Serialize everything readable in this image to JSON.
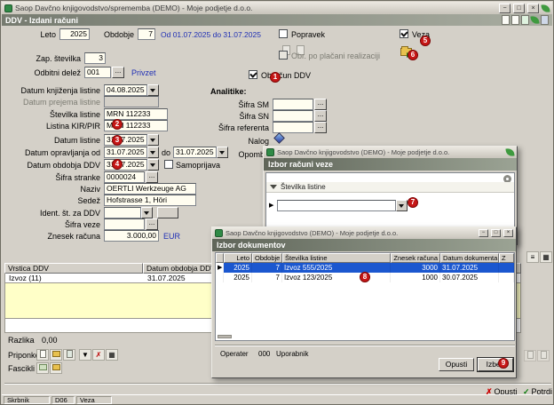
{
  "window": {
    "title": "Saop Davčno knjigovodstvo/sprememba (DEMO) - Moje podjetje d.o.o.",
    "form_title": "DDV - Izdani računi"
  },
  "icons": {
    "minimize": "−",
    "maximize": "□",
    "close": "×",
    "ellipsis": "...",
    "marker": "▶",
    "cross": "✗",
    "check": "✓",
    "lines": "≡",
    "grid": "▦",
    "down": "▼"
  },
  "top": {
    "leto_label": "Leto",
    "leto": "2025",
    "obdobje_label": "Obdobje",
    "obdobje": "7",
    "obdobje_range": "Od 01.07.2025 do 31.07.2025",
    "zap_label": "Zap. številka",
    "zap": "3",
    "odbitni_label": "Odbitni delež",
    "odbitni": "001",
    "privzet": "Privzet",
    "cb_popravek": "Popravek",
    "cb_veza": "Veza",
    "cb_obr": "Obr. po plačani realizaciji",
    "cb_obracun": "Obračun DDV"
  },
  "left": {
    "knjizenja_label": "Datum knjiženja listine",
    "knjizenja": "04.08.2025",
    "prejema_label": "Datum prejema listine",
    "prejema": "",
    "stevilka_label": "Številka listine",
    "stevilka": "MRN 112233",
    "kir_label": "Listina KIR/PIR",
    "kir": "MRN 112233",
    "datum_label": "Datum listine",
    "datum": "31.07.2025",
    "opravljanja_label": "Datum opravljanja od",
    "do_label": "do",
    "opravljanja_od": "31.07.2025",
    "opravljanja_do": "31.07.2025",
    "obdobja_label": "Datum obdobja DDV",
    "obdobja": "31.07.2025",
    "samoprijava": "Samoprijava",
    "stranka_label": "Šifra stranke",
    "stranka": "0000024",
    "naziv_label": "Naziv",
    "naziv": "OERTLI Werkzeuge AG",
    "sedez_label": "Sedež",
    "sedez": "Hofstrasse 1, Höri",
    "ident_label": "Ident. št. za DDV",
    "ident": "",
    "veze_label": "Šifra veze",
    "veze": "",
    "znesek_label": "Znesek računa",
    "znesek": "3.000,00",
    "valuta": "EUR"
  },
  "analitike": {
    "title": "Analitike:",
    "sm": "Šifra SM",
    "sn": "Šifra SN",
    "referent": "Šifra referenta",
    "nalog": "Nalog",
    "opombe": "Opombe"
  },
  "grid": {
    "col1": "Vrstica DDV",
    "col2": "Datum obdobja DDV",
    "row1_col1": "Izvoz (11)",
    "row1_col2": "31.07.2025",
    "razlika_label": "Razlika",
    "razlika": "0,00"
  },
  "bottom": {
    "priponke": "Priponke",
    "fascikli": "Fascikli",
    "opusti": "Opusti",
    "potrdi": "Potrdi"
  },
  "status": {
    "user": "Skrbnik",
    "code": "D06",
    "mode": "Veza"
  },
  "dlg_veza": {
    "title": "Saop Davčno knjigovodstvo (DEMO) - Moje podjetje d.o.o.",
    "header": "Izbor računi veze",
    "column": "Številka listine"
  },
  "dlg_dok": {
    "title": "Saop Davčno knjigovodstvo (DEMO) - Moje podjetje d.o.o.",
    "header": "Izbor dokumentov",
    "col_leto": "Leto",
    "col_obdobje": "Obdobje",
    "col_stevilka": "Številka listine",
    "col_znesek": "Znesek računa",
    "col_datum": "Datum dokumenta",
    "col_z": "Z",
    "rows": [
      {
        "leto": "2025",
        "obdobje": "7",
        "stevilka": "Izvoz 555/2025",
        "znesek": "3000",
        "datum": "31.07.2025"
      },
      {
        "leto": "2025",
        "obdobje": "7",
        "stevilka": "Izvoz 123/2025",
        "znesek": "1000",
        "datum": "30.07.2025"
      }
    ],
    "operater_label": "Operater",
    "operater": "000",
    "uporabnik": "Uporabnik",
    "opusti": "Opusti",
    "izberi": "Izberi"
  },
  "badges": [
    "1",
    "2",
    "3",
    "4",
    "5",
    "6",
    "7",
    "8",
    "9"
  ]
}
